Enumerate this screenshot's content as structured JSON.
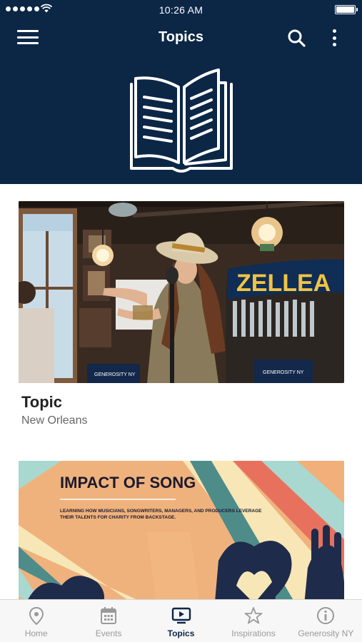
{
  "status_bar": {
    "time": "10:26 AM"
  },
  "header": {
    "title": "Topics",
    "background_color": "#0c2646",
    "icons": {
      "menu": "hamburger-menu-icon",
      "search": "search-icon",
      "more": "more-vertical-icon",
      "hero": "open-book-icon"
    }
  },
  "topics": [
    {
      "title": "Topic",
      "subtitle": "New Orleans",
      "image": {
        "description_icon": "performer-photo",
        "banner_text": "ZELLEA",
        "podium_text": "GENEROSITY NY"
      }
    },
    {
      "title": "",
      "subtitle": "",
      "image": {
        "headline": "IMPACT OF SONG",
        "tagline": "LEARNING HOW MUSICIANS, SONGWRITERS, MANAGERS, AND PRODUCERS LEVERAGE THEIR TALENTS FOR CHARITY FROM BACKSTAGE."
      }
    }
  ],
  "tabbar": {
    "active_color": "#0c2646",
    "inactive_color": "#9a9a9a",
    "items": [
      {
        "label": "Home",
        "icon": "location-pin-icon",
        "active": false
      },
      {
        "label": "Events",
        "icon": "calendar-icon",
        "active": false
      },
      {
        "label": "Topics",
        "icon": "video-play-icon",
        "active": true
      },
      {
        "label": "Inspirations",
        "icon": "star-icon",
        "active": false
      },
      {
        "label": "Generosity NY",
        "icon": "info-icon",
        "active": false
      }
    ]
  }
}
